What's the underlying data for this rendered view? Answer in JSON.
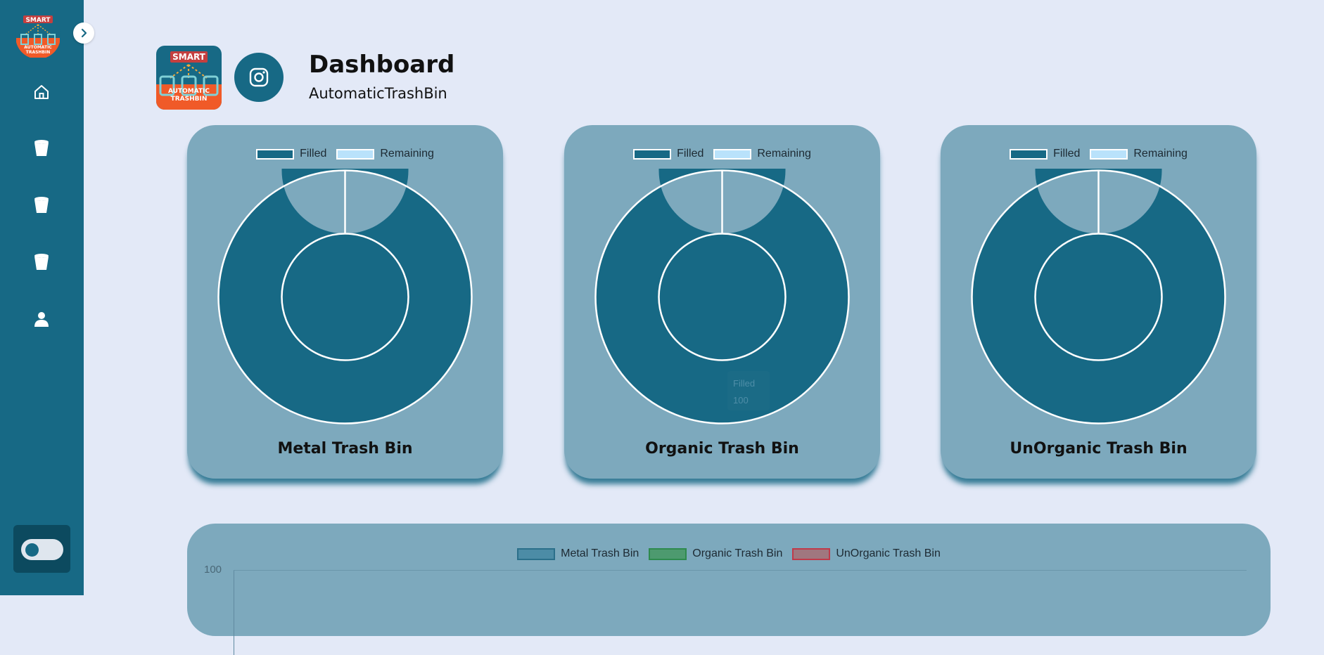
{
  "sidebar": {
    "logo": {
      "top_text": "SMART",
      "bottom_text_1": "AUTOMATIC",
      "bottom_text_2": "TRASHBIN"
    },
    "nav": [
      {
        "icon": "home-icon"
      },
      {
        "icon": "bin-icon"
      },
      {
        "icon": "bin-icon"
      },
      {
        "icon": "bin-icon"
      },
      {
        "icon": "user-icon"
      }
    ],
    "theme_toggle": {
      "state": "off"
    }
  },
  "header": {
    "title": "Dashboard",
    "subtitle": "AutomaticTrashBin",
    "social_icon": "instagram-icon"
  },
  "colors": {
    "background": "#e3e9f7",
    "sidebar": "#176985",
    "card": "#7da9bd",
    "filled": "#176985",
    "remaining": "#b9e2fb",
    "metal": "#4c8ca6",
    "organic": "#4d9a6f",
    "unorganic": "#a0777f"
  },
  "cards": [
    {
      "title": "Metal Trash Bin",
      "legend": [
        "Filled",
        "Remaining"
      ]
    },
    {
      "title": "Organic Trash Bin",
      "legend": [
        "Filled",
        "Remaining"
      ],
      "tooltip": {
        "title": "Filled",
        "value": "100"
      }
    },
    {
      "title": "UnOrganic Trash Bin",
      "legend": [
        "Filled",
        "Remaining"
      ]
    }
  ],
  "chart_data": [
    {
      "type": "pie",
      "title": "Metal Trash Bin",
      "categories": [
        "Filled",
        "Remaining"
      ],
      "values": [
        100,
        0
      ],
      "legend": "top"
    },
    {
      "type": "pie",
      "title": "Organic Trash Bin",
      "categories": [
        "Filled",
        "Remaining"
      ],
      "values": [
        100,
        0
      ],
      "legend": "top"
    },
    {
      "type": "pie",
      "title": "UnOrganic Trash Bin",
      "categories": [
        "Filled",
        "Remaining"
      ],
      "values": [
        100,
        0
      ],
      "legend": "top"
    },
    {
      "type": "bar",
      "series": [
        {
          "name": "Metal Trash Bin"
        },
        {
          "name": "Organic Trash Bin"
        },
        {
          "name": "UnOrganic Trash Bin"
        }
      ],
      "y_ticks": [
        "100"
      ],
      "legend": "top"
    }
  ]
}
